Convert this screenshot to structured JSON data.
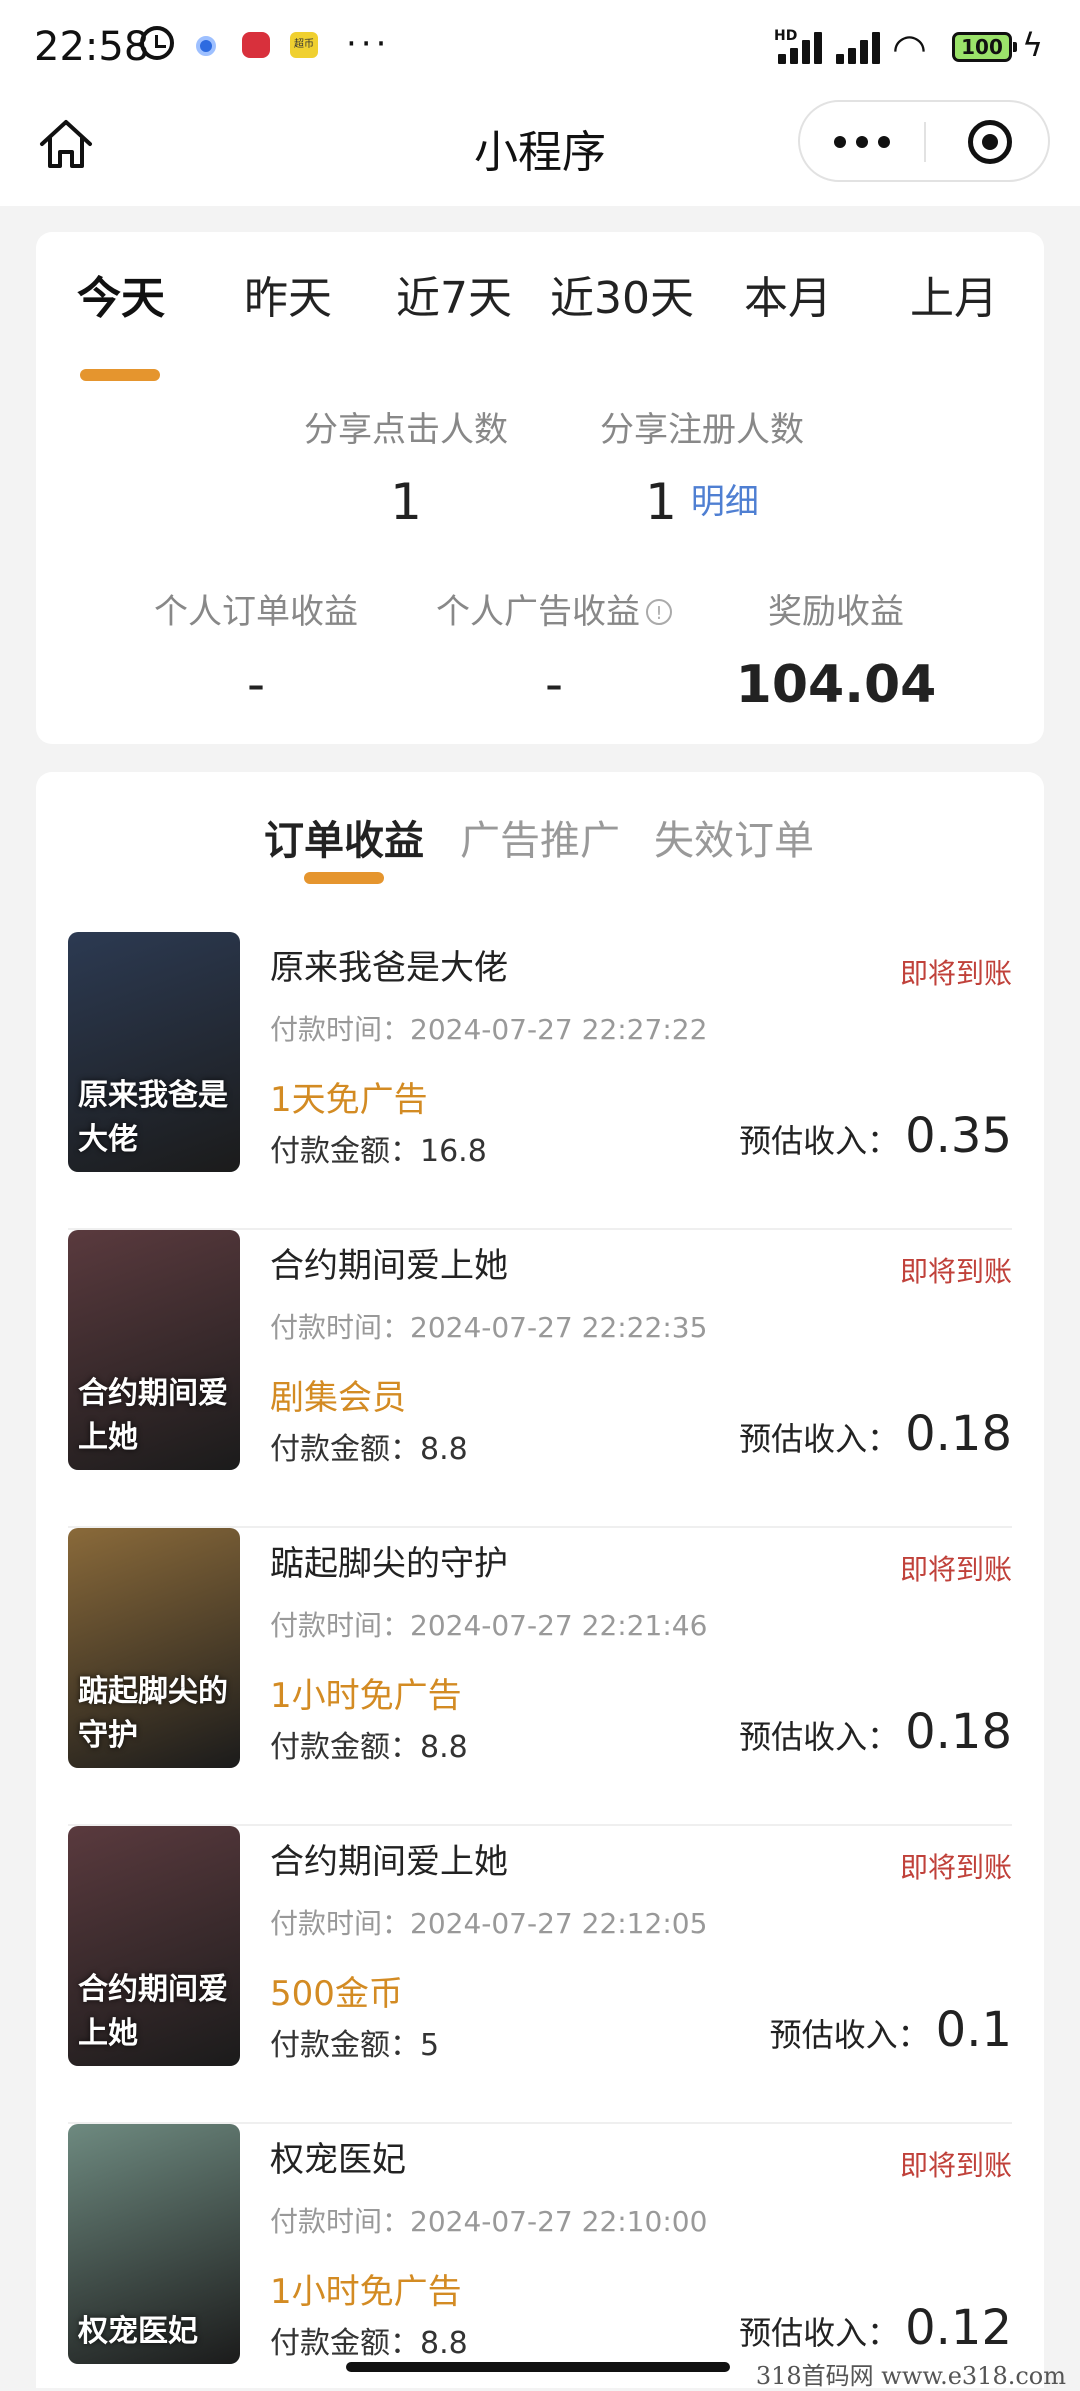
{
  "status_bar": {
    "time": "22:58",
    "more": "···",
    "network": "HD",
    "battery": "100",
    "app3": "超币"
  },
  "nav": {
    "title": "小程序"
  },
  "stats": {
    "tabs": [
      "今天",
      "昨天",
      "近7天",
      "近30天",
      "本月",
      "上月"
    ],
    "share_click_label": "分享点击人数",
    "share_click_value": "1",
    "share_register_label": "分享注册人数",
    "share_register_value": "1",
    "detail_link": "明细",
    "personal_order_label": "个人订单收益",
    "personal_order_value": "-",
    "personal_ad_label": "个人广告收益",
    "personal_ad_value": "-",
    "reward_label": "奖励收益",
    "reward_value": "104.04"
  },
  "order_tabs": [
    "订单收益",
    "广告推广",
    "失效订单"
  ],
  "orders": [
    {
      "title": "原来我爸是大佬",
      "status": "即将到账",
      "time": "付款时间：2024-07-27 22:27:22",
      "tag": "1天免广告",
      "amount": "付款金额：16.8",
      "est_label": "预估收入：",
      "est_value": "0.35",
      "poster_text": "原来我爸是大佬",
      "poster_color": "#2c3a52"
    },
    {
      "title": "合约期间爱上她",
      "status": "即将到账",
      "time": "付款时间：2024-07-27 22:22:35",
      "tag": "剧集会员",
      "amount": "付款金额：8.8",
      "est_label": "预估收入：",
      "est_value": "0.18",
      "poster_text": "合约期间爱上她",
      "poster_color": "#5a3a3e"
    },
    {
      "title": "踮起脚尖的守护",
      "status": "即将到账",
      "time": "付款时间：2024-07-27 22:21:46",
      "tag": "1小时免广告",
      "amount": "付款金额：8.8",
      "est_label": "预估收入：",
      "est_value": "0.18",
      "poster_text": "踮起脚尖的守护",
      "poster_color": "#8a6a3a"
    },
    {
      "title": "合约期间爱上她",
      "status": "即将到账",
      "time": "付款时间：2024-07-27 22:12:05",
      "tag": "500金币",
      "amount": "付款金额：5",
      "est_label": "预估收入：",
      "est_value": "0.1",
      "poster_text": "合约期间爱上她",
      "poster_color": "#5a3a3e"
    },
    {
      "title": "权宠医妃",
      "status": "即将到账",
      "time": "付款时间：2024-07-27 22:10:00",
      "tag": "1小时免广告",
      "amount": "付款金额：8.8",
      "est_label": "预估收入：",
      "est_value": "0.12",
      "poster_text": "权宠医妃",
      "poster_color": "#6e8a80"
    }
  ],
  "watermark": "318首码网  www.e318.com",
  "colors": {
    "accent": "#e5952e",
    "status": "#c0413a",
    "tag": "#d38b23",
    "link": "#4f7fd2"
  }
}
